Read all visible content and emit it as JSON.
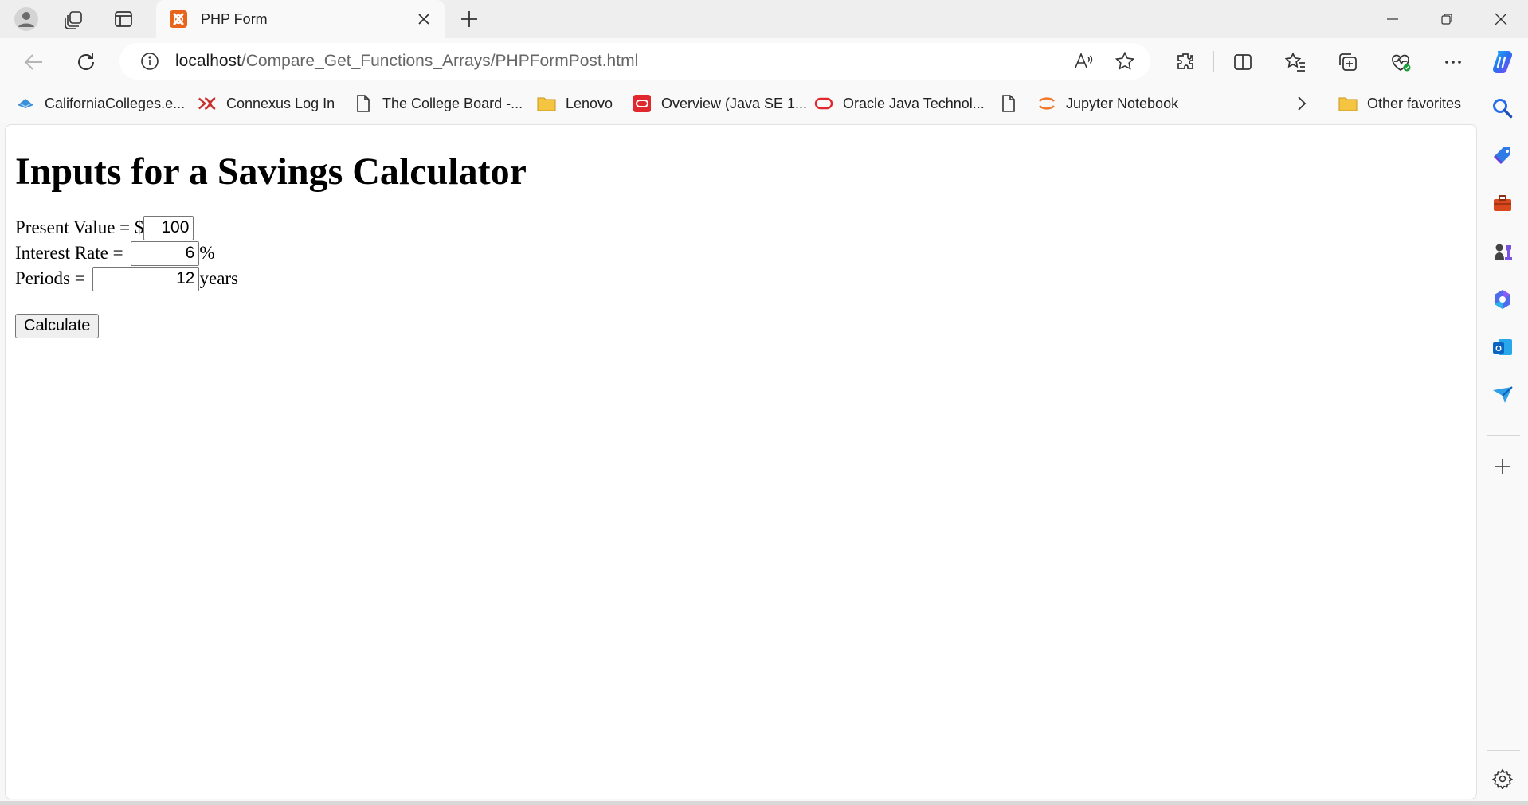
{
  "browser": {
    "tab": {
      "title": "PHP Form"
    },
    "url": {
      "host": "localhost",
      "path": "/Compare_Get_Functions_Arrays/PHPFormPost.html"
    },
    "favorites": [
      {
        "label": "CaliforniaColleges.e...",
        "icon": "graduation-icon"
      },
      {
        "label": "Connexus Log In",
        "icon": "connexus-icon"
      },
      {
        "label": "The College Board -...",
        "icon": "page-icon"
      },
      {
        "label": "Lenovo",
        "icon": "folder-icon"
      },
      {
        "label": "Overview (Java SE 1...",
        "icon": "oracle-icon"
      },
      {
        "label": "Oracle Java Technol...",
        "icon": "oracle-ring-icon"
      },
      {
        "label": "",
        "icon": "page-icon"
      },
      {
        "label": "Jupyter Notebook",
        "icon": "jupyter-icon"
      }
    ],
    "other_favorites": "Other favorites",
    "colors": {
      "accent": "#0f6cbd",
      "php_orange": "#e8641b",
      "oracle_red": "#e0282e"
    }
  },
  "page": {
    "heading": "Inputs for a Savings Calculator",
    "fields": [
      {
        "label": "Present Value = $",
        "value": "100",
        "suffix": ""
      },
      {
        "label": "Interest Rate = ",
        "value": "6",
        "suffix": "%"
      },
      {
        "label": "Periods = ",
        "value": "12",
        "suffix": "years"
      }
    ],
    "submit_label": "Calculate"
  }
}
